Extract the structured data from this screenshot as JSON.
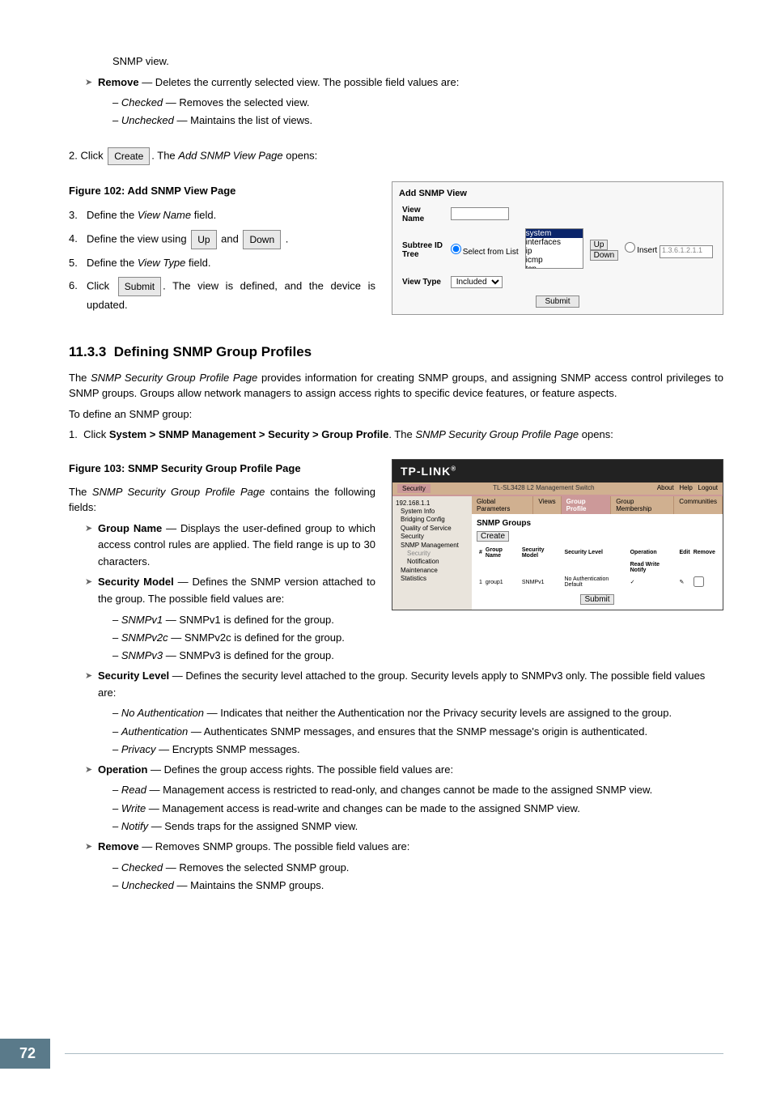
{
  "snmp_view_tail": "SNMP view.",
  "remove": {
    "label": "Remove",
    "desc": " — Deletes the currently selected view. The possible field values are:",
    "checked": "Checked",
    "checked_desc": " — Removes the selected view.",
    "unchecked": "Unchecked",
    "unchecked_desc": " — Maintains the list of views."
  },
  "step2": {
    "pre": "2. Click ",
    "btn": "Create",
    "post": ". The ",
    "pagename": "Add SNMP View Page",
    "opens": " opens:"
  },
  "fig102": "Figure 102: Add SNMP View Page",
  "steps": {
    "s3": {
      "num": "3.",
      "pre": "Define the ",
      "field": "View Name",
      "post": " field."
    },
    "s4": {
      "num": "4.",
      "pre": "Define the view using ",
      "up": "Up",
      "and": " and ",
      "down": "Down",
      "post": " ."
    },
    "s5": {
      "num": "5.",
      "pre": "Define the ",
      "field": "View Type",
      "post": " field."
    },
    "s6": {
      "num": "6.",
      "pre": "Click ",
      "btn": "Submit",
      "post": ". The view is defined, and the device is updated."
    }
  },
  "panel1": {
    "title": "Add SNMP View",
    "view_name_label": "View Name",
    "subtree_label": "Subtree ID Tree",
    "select_from_list": "Select from List",
    "list_items": [
      "system",
      "interfaces",
      "ip",
      "icmp",
      "tcp"
    ],
    "up": "Up",
    "down": "Down",
    "insert_label": "Insert",
    "insert_val": "1.3.6.1.2.1.1",
    "view_type_label": "View Type",
    "view_type_val": "Included",
    "submit": "Submit"
  },
  "section": {
    "num": "11.3.3",
    "title": "Defining SNMP Group Profiles"
  },
  "section_intro1_pre": "The ",
  "section_intro1_page": "SNMP Security Group Profile Page",
  "section_intro1_post": " provides information for creating SNMP groups, and assigning SNMP access control privileges to SNMP groups. Groups allow network managers to assign access rights to specific device features, or feature aspects.",
  "define_group": "To define an SNMP group:",
  "nav": {
    "num": "1.",
    "pre": "Click ",
    "path": "System > SNMP Management > Security > Group Profile",
    "post": ". The ",
    "page": "SNMP Security Group Profile Page",
    "opens": " opens:"
  },
  "fig103": "Figure 103: SNMP Security Group Profile Page",
  "contains_pre": "The ",
  "contains_page": "SNMP Security Group Profile Page",
  "contains_post": " contains the following fields:",
  "fields": {
    "group_name": {
      "label": "Group Name",
      "desc": " — Displays the user-defined group to which access control rules are applied. The field range is up to 30 characters."
    },
    "sec_model": {
      "label": "Security Model",
      "desc": " — Defines the SNMP version attached to the group. The possible field values are:",
      "v1": "SNMPv1",
      "v1d": " — SNMPv1 is defined for the group.",
      "v2": "SNMPv2c",
      "v2d": " — SNMPv2c is defined for the group.",
      "v3": "SNMPv3",
      "v3d": " — SNMPv3 is defined for the group."
    },
    "sec_level": {
      "label": "Security Level",
      "desc": " — Defines the security level attached to the group. Security levels apply to SNMPv3 only. The possible field values are:",
      "noauth": "No Authentication",
      "noauthd": " — Indicates that neither the Authentication nor the Privacy security levels are assigned to the group.",
      "auth": "Authentication",
      "authd": " — Authenticates SNMP messages, and ensures that the SNMP message's origin is authenticated.",
      "priv": "Privacy",
      "privd": " — Encrypts SNMP messages."
    },
    "operation": {
      "label": "Operation",
      "desc": " — Defines the group access rights. The possible field values are:",
      "read": "Read",
      "readd": " — Management access is restricted to read-only, and changes cannot be made to the assigned SNMP view.",
      "write": "Write",
      "writed": " — Management access is read-write and changes can be made to the assigned SNMP view.",
      "notify": "Notify",
      "notifyd": " — Sends traps for the assigned SNMP view."
    },
    "remove2": {
      "label": "Remove",
      "desc": " — Removes SNMP groups. The possible field values are:",
      "checked": "Checked",
      "checkedd": " — Removes the selected SNMP group.",
      "unchecked": "Unchecked",
      "uncheckedd": " — Maintains the SNMP groups."
    }
  },
  "panel2": {
    "logo": "TP-LINK",
    "product": "TL-SL3428 L2 Management Switch",
    "top_links": [
      "About",
      "Help",
      "Logout"
    ],
    "breadcrumb": "Security",
    "tabs": [
      "Global Parameters",
      "Views",
      "Group Profile",
      "Group Membership",
      "Communities"
    ],
    "tree": [
      "192.168.1.1",
      "System Info",
      "Bridging Config",
      "Quality of Service",
      "Security",
      "SNMP Management",
      "Security",
      "Notification",
      "Maintenance",
      "Statistics"
    ],
    "body_title": "SNMP Groups",
    "create": "Create",
    "table_headers": [
      "#",
      "Group Name",
      "Security Model",
      "Security Level",
      "Operation",
      "Edit",
      "Remove"
    ],
    "op_sub": "Read  Write  Notify",
    "row": [
      "1",
      "group1",
      "SNMPv1",
      "No Authentication Default",
      "✓",
      "",
      "☐"
    ],
    "submit": "Submit"
  },
  "page_number": "72"
}
